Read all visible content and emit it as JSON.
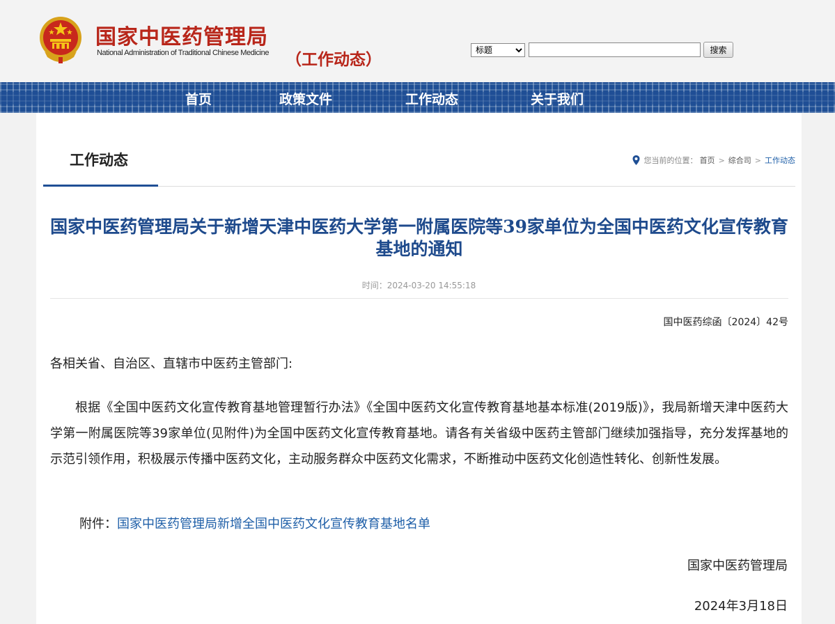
{
  "header": {
    "site_title": "国家中医药管理局",
    "site_subtitle": "National Administration of Traditional Chinese Medicine",
    "channel_label": "（工作动态）",
    "search": {
      "scope_selected": "标题",
      "input_value": "",
      "button_label": "搜索"
    }
  },
  "nav": {
    "items": [
      {
        "label": "首页"
      },
      {
        "label": "政策文件"
      },
      {
        "label": "工作动态"
      },
      {
        "label": "关于我们"
      }
    ]
  },
  "section": {
    "title": "工作动态",
    "breadcrumb": {
      "prefix": "您当前的位置：",
      "items": [
        "首页",
        "综合司",
        "工作动态"
      ],
      "separator": ">"
    }
  },
  "article": {
    "title": "国家中医药管理局关于新增天津中医药大学第一附属医院等39家单位为全国中医药文化宣传教育基地的通知",
    "time": "时间：2024-03-20 14:55:18",
    "doc_number": "国中医药综函〔2024〕42号",
    "salutation": "各相关省、自治区、直辖市中医药主管部门:",
    "paragraph": "根据《全国中医药文化宣传教育基地管理暂行办法》《全国中医药文化宣传教育基地基本标准(2019版)》，我局新增天津中医药大学第一附属医院等39家单位(见附件)为全国中医药文化宣传教育基地。请各有关省级中医药主管部门继续加强指导，充分发挥基地的示范引领作用，积极展示传播中医药文化，主动服务群众中医药文化需求，不断推动中医药文化创造性转化、创新性发展。",
    "attachment_label": "附件：",
    "attachment_link": "国家中医药管理局新增全国中医药文化宣传教育基地名单",
    "signature": "国家中医药管理局",
    "date": "2024年3月18日"
  },
  "colors": {
    "brand_red": "#b8261a",
    "nav_blue": "#1f4f95",
    "title_blue": "#1e4a8c",
    "link_blue": "#1f5fa8"
  },
  "icons": [
    "national-emblem-icon",
    "location-pin-icon"
  ]
}
